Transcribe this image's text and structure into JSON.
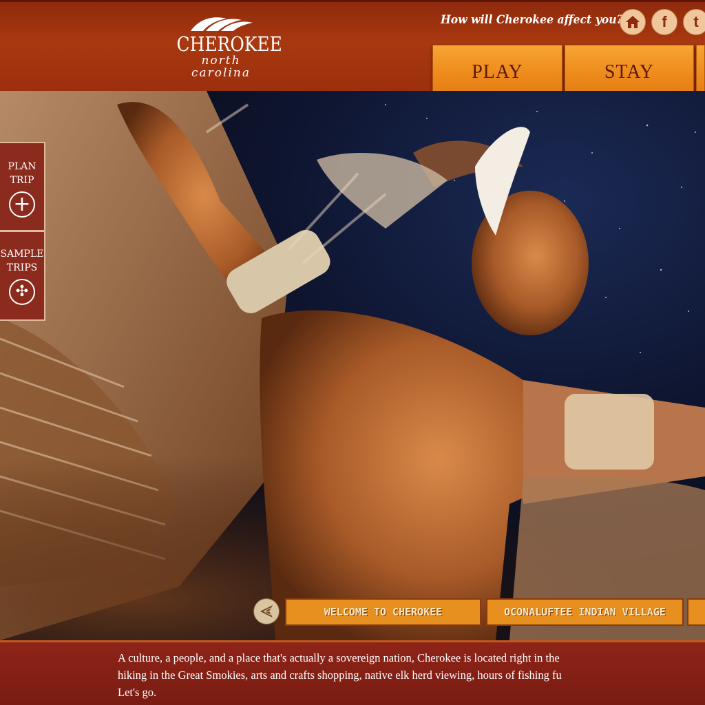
{
  "header": {
    "brand": "CHEROKEE",
    "brand_sub": "north carolina",
    "tagline": "How will Cherokee affect you?",
    "social": [
      {
        "icon": "home-icon",
        "glyph": "⌂"
      },
      {
        "icon": "facebook-icon",
        "glyph": "f"
      },
      {
        "icon": "twitter-icon",
        "glyph": "t"
      }
    ],
    "nav": [
      "PLAY",
      "STAY"
    ]
  },
  "sidebar": {
    "plan_trip": {
      "line1": "PLAN",
      "line2": "TRIP",
      "icon": "plus-circle-icon",
      "glyph": "+"
    },
    "sample_trips": {
      "line1": "SAMPLE",
      "line2": "TRIPS",
      "icon": "knot-symbol-icon",
      "glyph": "✣"
    }
  },
  "carousel": {
    "arrow_icon": "feather-arrow-icon",
    "slides": [
      "WELCOME TO CHEROKEE",
      "OCONALUFTEE INDIAN VILLAGE"
    ]
  },
  "intro": {
    "line1": "A culture, a people, and a place that's actually a sovereign nation, Cherokee is located right in the",
    "line2": "hiking in the Great Smokies, arts and crafts shopping, native elk herd viewing, hours of fishing fu",
    "line3": "Let's go."
  },
  "colors": {
    "header_bg": "#a8380f",
    "nav_orange": "#ee8a1c",
    "footer_bg": "#8e2418",
    "sidebar_bg": "#8a2b1e"
  }
}
